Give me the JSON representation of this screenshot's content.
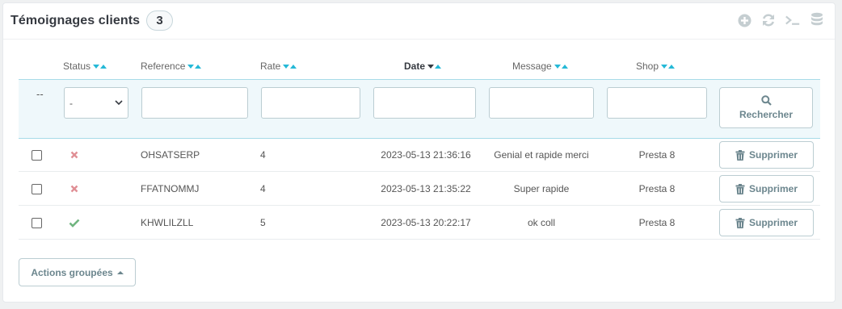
{
  "panel": {
    "title": "Témoignages clients",
    "count": "3",
    "tools": [
      "plus-circle-icon",
      "refresh-icon",
      "terminal-icon",
      "database-icon"
    ]
  },
  "columns": {
    "status": "Status",
    "reference": "Reference",
    "rate": "Rate",
    "date": "Date",
    "message": "Message",
    "shop": "Shop"
  },
  "filters": {
    "bulk_placeholder": "--",
    "status_value": "-",
    "search_label": "Rechercher"
  },
  "rows": [
    {
      "status": "disabled",
      "reference": "OHSATSERP",
      "rate": "4",
      "date": "2023-05-13 21:36:16",
      "message": "Genial et rapide merci",
      "shop": "Presta 8",
      "delete_label": "Supprimer"
    },
    {
      "status": "disabled",
      "reference": "FFATNOMMJ",
      "rate": "4",
      "date": "2023-05-13 21:35:22",
      "message": "Super rapide",
      "shop": "Presta 8",
      "delete_label": "Supprimer"
    },
    {
      "status": "enabled",
      "reference": "KHWLILZLL",
      "rate": "5",
      "date": "2023-05-13 20:22:17",
      "message": "ok coll",
      "shop": "Presta 8",
      "delete_label": "Supprimer"
    }
  ],
  "bulk_actions_label": "Actions groupées",
  "colors": {
    "accent": "#25b9d7",
    "disabled": "#e08f95",
    "enabled": "#70b580"
  }
}
